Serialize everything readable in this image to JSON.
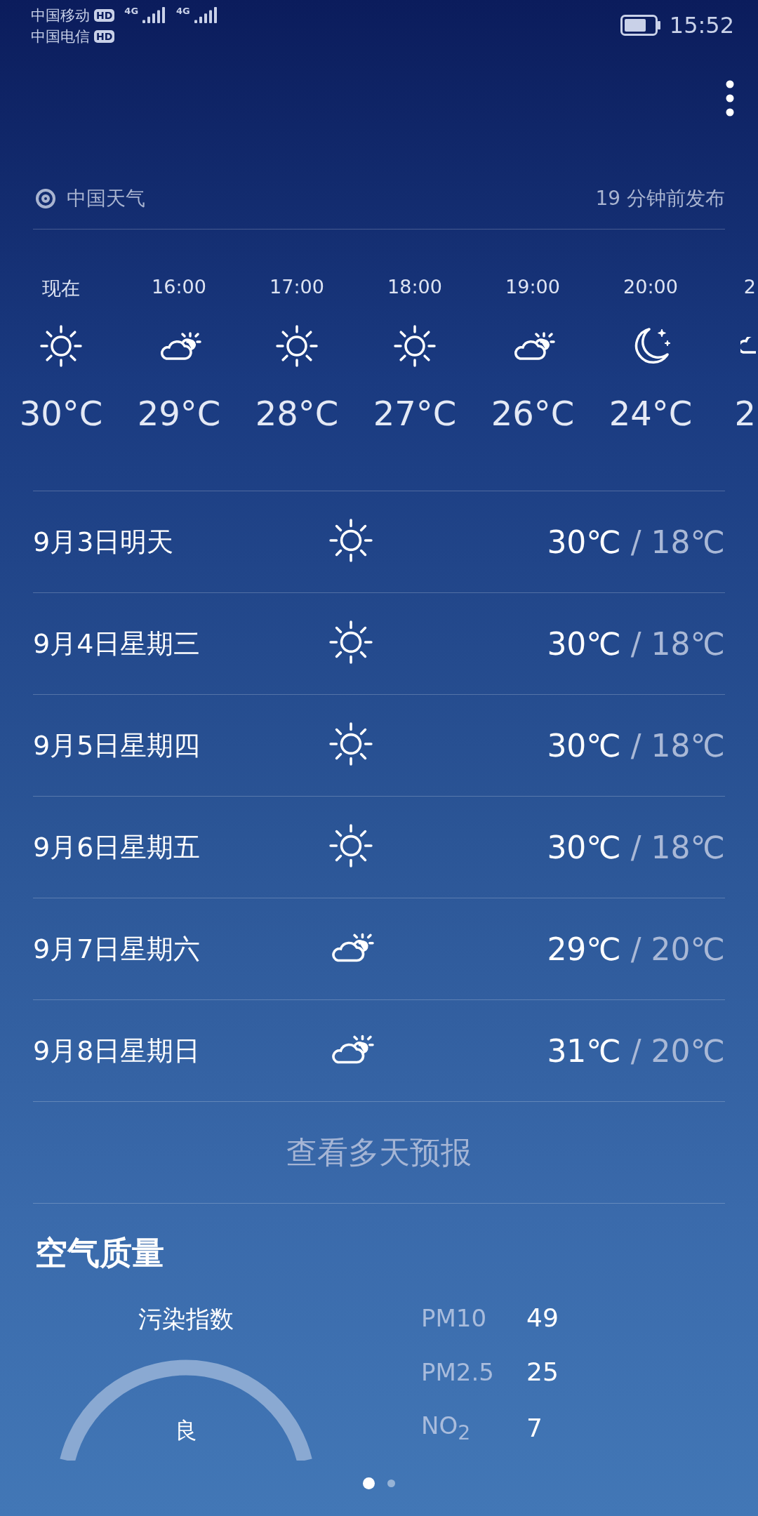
{
  "status_bar": {
    "carriers": [
      {
        "name": "中国移动",
        "badge": "HD",
        "network": "4G"
      },
      {
        "name": "中国电信",
        "badge": "HD",
        "network": "4G"
      }
    ],
    "time": "15:52"
  },
  "source": {
    "name": "中国天气",
    "published": "19 分钟前发布"
  },
  "hourly": [
    {
      "time": "现在",
      "kind": "sunny",
      "temp": "30°C"
    },
    {
      "time": "16:00",
      "kind": "cloudy",
      "temp": "29°C"
    },
    {
      "time": "17:00",
      "kind": "sunny",
      "temp": "28°C"
    },
    {
      "time": "18:00",
      "kind": "sunny",
      "temp": "27°C"
    },
    {
      "time": "19:00",
      "kind": "cloudy",
      "temp": "26°C"
    },
    {
      "time": "20:00",
      "kind": "night",
      "temp": "24°C"
    },
    {
      "time": "2",
      "kind": "cloudy",
      "temp": "2"
    }
  ],
  "daily": [
    {
      "day": "9月3日明天",
      "kind": "sunny",
      "high": "30℃",
      "low": "/ 18℃"
    },
    {
      "day": "9月4日星期三",
      "kind": "sunny",
      "high": "30℃",
      "low": "/ 18℃"
    },
    {
      "day": "9月5日星期四",
      "kind": "sunny",
      "high": "30℃",
      "low": "/ 18℃"
    },
    {
      "day": "9月6日星期五",
      "kind": "sunny",
      "high": "30℃",
      "low": "/ 18℃"
    },
    {
      "day": "9月7日星期六",
      "kind": "cloudy",
      "high": "29℃",
      "low": "/ 20℃"
    },
    {
      "day": "9月8日星期日",
      "kind": "cloudy",
      "high": "31℃",
      "low": "/ 20℃"
    }
  ],
  "more_link": "查看多天预报",
  "air_quality": {
    "title": "空气质量",
    "index_label": "污染指数",
    "grade": "良",
    "pollutants": [
      {
        "name": "PM10",
        "value": "49"
      },
      {
        "name": "PM2.5",
        "value": "25"
      },
      {
        "name": "NO$_{2}$",
        "value": "7"
      }
    ]
  },
  "pager": [
    {
      "selected": true
    },
    {
      "selected": false
    }
  ]
}
